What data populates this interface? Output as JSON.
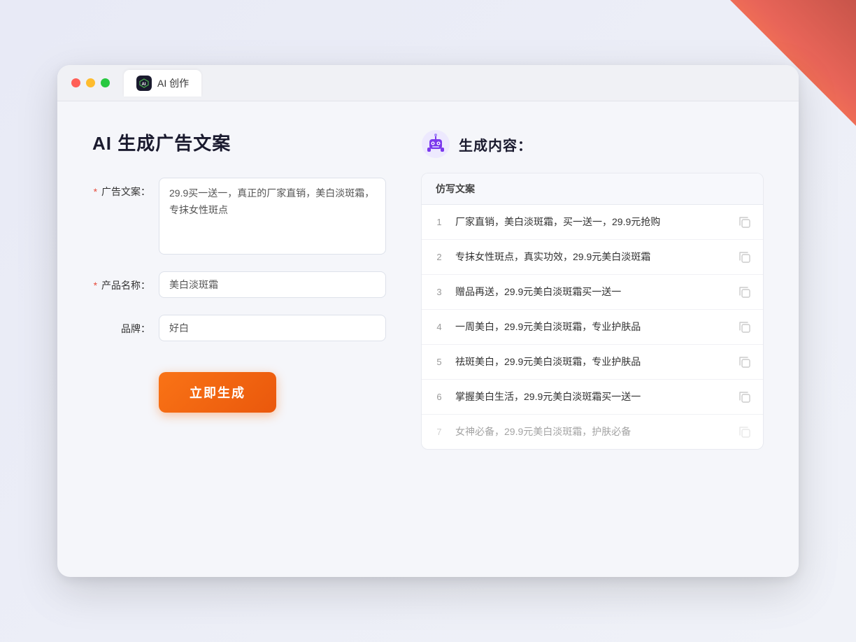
{
  "browser": {
    "tab_label": "AI 创作",
    "traffic_lights": [
      "red",
      "yellow",
      "green"
    ]
  },
  "left_panel": {
    "title": "AI 生成广告文案",
    "fields": [
      {
        "id": "ad_copy",
        "label": "广告文案：",
        "required": true,
        "type": "textarea",
        "value": "29.9买一送一，真正的厂家直销，美白淡斑霜，专抹女性斑点"
      },
      {
        "id": "product_name",
        "label": "产品名称：",
        "required": true,
        "type": "input",
        "value": "美白淡斑霜"
      },
      {
        "id": "brand",
        "label": "品牌：",
        "required": false,
        "type": "input",
        "value": "好白"
      }
    ],
    "generate_button": "立即生成"
  },
  "right_panel": {
    "title": "生成内容：",
    "column_header": "仿写文案",
    "results": [
      {
        "num": "1",
        "text": "厂家直销，美白淡斑霜，买一送一，29.9元抢购",
        "dimmed": false
      },
      {
        "num": "2",
        "text": "专抹女性斑点，真实功效，29.9元美白淡斑霜",
        "dimmed": false
      },
      {
        "num": "3",
        "text": "赠品再送，29.9元美白淡斑霜买一送一",
        "dimmed": false
      },
      {
        "num": "4",
        "text": "一周美白，29.9元美白淡斑霜，专业护肤品",
        "dimmed": false
      },
      {
        "num": "5",
        "text": "祛斑美白，29.9元美白淡斑霜，专业护肤品",
        "dimmed": false
      },
      {
        "num": "6",
        "text": "掌握美白生活，29.9元美白淡斑霜买一送一",
        "dimmed": false
      },
      {
        "num": "7",
        "text": "女神必备，29.9元美白淡斑霜，护肤必备",
        "dimmed": true
      }
    ]
  }
}
